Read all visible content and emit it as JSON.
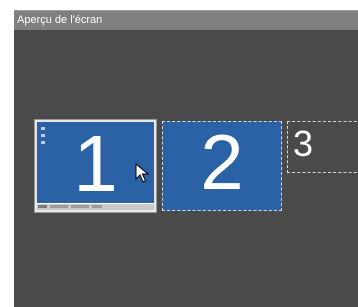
{
  "window": {
    "title": "Aperçu de l'écran"
  },
  "monitors": [
    {
      "number": "1",
      "selected": true,
      "shows_desktop": true
    },
    {
      "number": "2",
      "selected": false,
      "shows_desktop": false
    },
    {
      "number": "3",
      "selected": false,
      "shows_desktop": false
    }
  ],
  "colors": {
    "canvas": "#4a4a4a",
    "monitor_fill": "#2b62a5",
    "titlebar": "#7f7f7f"
  },
  "icons": [
    "mouse-cursor-icon"
  ]
}
